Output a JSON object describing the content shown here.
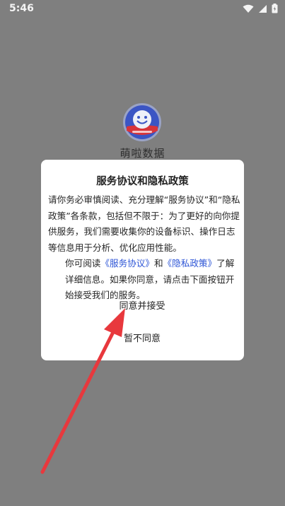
{
  "status_bar": {
    "time": "5:46",
    "icons": [
      "wifi-icon",
      "signal-icon",
      "battery-icon"
    ]
  },
  "app": {
    "name": "萌啦数据",
    "logo_icon": "smiley-face-logo"
  },
  "dialog": {
    "title": "服务协议和隐私政策",
    "paragraph1": "请你务必审慎阅读、充分理解“服务协议”和“隐私政策”各条款，包括但不限于：为了更好的向你提供服务，我们需要收集你的设备标识、操作日志等信息用于分析、优化应用性能。",
    "paragraph2_prefix": "你可阅读",
    "service_agreement_link": "《服务协议》",
    "paragraph2_and": "和",
    "privacy_policy_link": "《隐私政策》",
    "paragraph2_suffix": "了解详细信息。如果你同意，请点击下面按钮开始接受我们的服务。",
    "accept_label": "同意并接受",
    "decline_label": "暂不同意"
  },
  "colors": {
    "overlay": "#7f7f7f",
    "link": "#2d55d6",
    "annotation_arrow": "#e8383d",
    "logo_blue": "#3b55c4",
    "logo_red": "#d8343a"
  }
}
